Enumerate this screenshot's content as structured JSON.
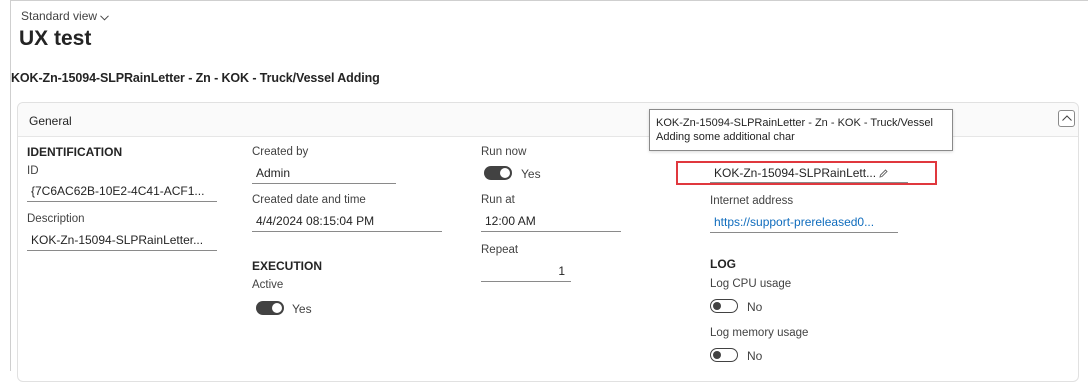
{
  "header": {
    "view_selector": "Standard view",
    "title": "UX test",
    "record_caption": "KOK-Zn-15094-SLPRainLetter - Zn - KOK - Truck/Vessel Adding"
  },
  "card": {
    "title": "General",
    "identification": {
      "group_label": "IDENTIFICATION",
      "id_label": "ID",
      "id_value": "{7C6AC62B-10E2-4C41-ACF1...",
      "description_label": "Description",
      "description_value": "KOK-Zn-15094-SLPRainLetter..."
    },
    "created": {
      "created_by_label": "Created by",
      "created_by_value": "Admin",
      "created_datetime_label": "Created date and time",
      "created_datetime_value": "4/4/2024 08:15:04 PM"
    },
    "execution": {
      "group_label": "EXECUTION",
      "active_label": "Active",
      "active_value": "Yes"
    },
    "schedule": {
      "run_now_label": "Run now",
      "run_now_value": "Yes",
      "run_at_label": "Run at",
      "run_at_value": "12:00 AM",
      "repeat_label": "Repeat",
      "repeat_value": "1"
    },
    "name_field": {
      "value": "KOK-Zn-15094-SLPRainLett..."
    },
    "internet": {
      "label": "Internet address",
      "value": "https://support-prereleased0..."
    },
    "log": {
      "group_label": "LOG",
      "cpu_label": "Log CPU usage",
      "cpu_value": "No",
      "memory_label": "Log memory usage",
      "memory_value": "No"
    }
  },
  "tooltip": {
    "line1": "KOK-Zn-15094-SLPRainLetter - Zn - KOK - Truck/Vessel",
    "line2": "Adding some additional char"
  },
  "colors": {
    "accent_link": "#0f6cbd",
    "highlight_border": "#e0383e",
    "toggle_dark": "#424242"
  },
  "icons": {
    "view_dropdown": "chevron-down-icon",
    "collapse": "chevron-up-icon",
    "edit": "pencil-icon"
  }
}
